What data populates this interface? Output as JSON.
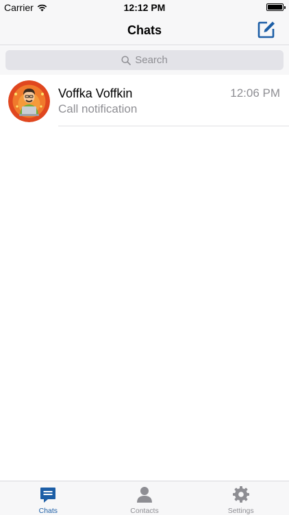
{
  "status_bar": {
    "carrier": "Carrier",
    "time": "12:12 PM"
  },
  "nav": {
    "title": "Chats"
  },
  "search": {
    "placeholder": "Search"
  },
  "chats": [
    {
      "name": "Voffka Voffkin",
      "time": "12:06 PM",
      "preview": "Call notification"
    }
  ],
  "tabs": [
    {
      "label": "Chats",
      "icon": "chat-bubble-icon",
      "active": true
    },
    {
      "label": "Contacts",
      "icon": "person-icon",
      "active": false
    },
    {
      "label": "Settings",
      "icon": "gear-icon",
      "active": false
    }
  ],
  "colors": {
    "accent": "#1c5ea6",
    "inactive": "#8e8e93",
    "bar_bg": "#f7f7f8"
  }
}
